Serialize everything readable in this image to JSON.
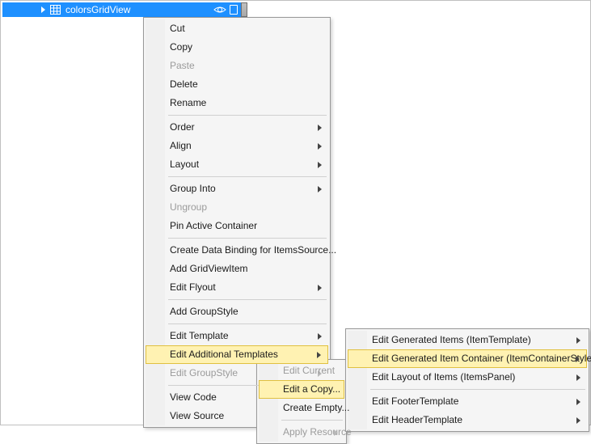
{
  "node": {
    "label": "colorsGridView"
  },
  "menu_main": {
    "cut": "Cut",
    "copy": "Copy",
    "paste": "Paste",
    "delete": "Delete",
    "rename": "Rename",
    "order": "Order",
    "align": "Align",
    "layout": "Layout",
    "group_into": "Group Into",
    "ungroup": "Ungroup",
    "pin": "Pin Active Container",
    "binding": "Create Data Binding for ItemsSource...",
    "add_gvi": "Add GridViewItem",
    "edit_flyout": "Edit Flyout",
    "add_groupstyle": "Add GroupStyle",
    "edit_template": "Edit Template",
    "edit_additional": "Edit Additional Templates",
    "edit_groupstyle": "Edit GroupStyle",
    "view_code": "View Code",
    "view_source": "View Source"
  },
  "menu_sub1": {
    "edit_current": "Edit Current",
    "edit_copy": "Edit a Copy...",
    "create_empty": "Create Empty...",
    "apply_resource": "Apply Resource"
  },
  "menu_sub2": {
    "gen_items": "Edit Generated Items (ItemTemplate)",
    "gen_container": "Edit Generated Item Container (ItemContainerStyle)",
    "layout_items": "Edit Layout of Items (ItemsPanel)",
    "footer": "Edit FooterTemplate",
    "header": "Edit HeaderTemplate"
  }
}
